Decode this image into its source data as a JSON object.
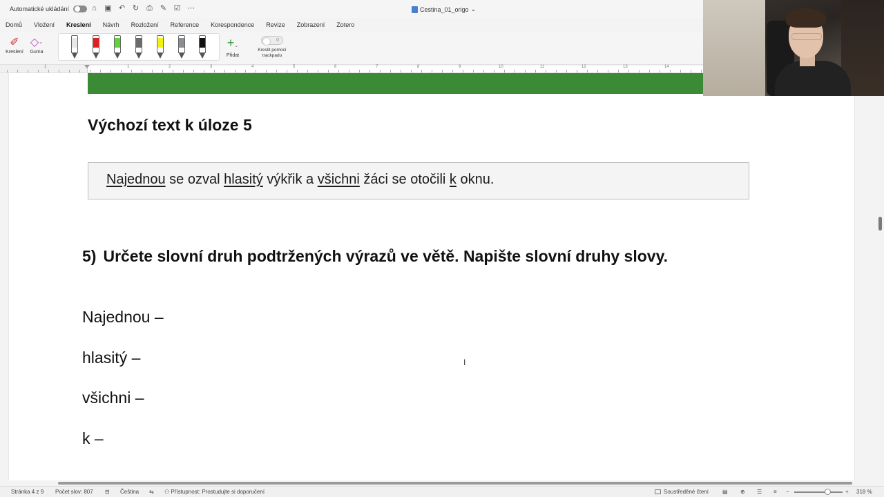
{
  "titlebar": {
    "autosave_label": "Automatické ukládání",
    "document_title": "Cestina_01_origo"
  },
  "ribbon_tabs": [
    "Domů",
    "Vložení",
    "Kreslení",
    "Návrh",
    "Rozložení",
    "Reference",
    "Korespondence",
    "Revize",
    "Zobrazení",
    "Zotero"
  ],
  "active_tab": "Kreslení",
  "ribbon": {
    "draw_label": "Kreslení",
    "eraser_label": "Guma",
    "add_label": "Přidat",
    "trackpad_label": "Kreslit pomocí trackpadu",
    "trackpad_toggle_value": "0",
    "pens": [
      {
        "name": "pencil-gray",
        "color": "#e8e8e8"
      },
      {
        "name": "pen-red",
        "color": "#e02020"
      },
      {
        "name": "pen-green",
        "color": "#5fd33a"
      },
      {
        "name": "pencil-dark",
        "color": "#6b6b6b"
      },
      {
        "name": "highlighter-yellow",
        "color": "#f3f016"
      },
      {
        "name": "highlighter-gray",
        "color": "#8a8f93"
      },
      {
        "name": "pen-black",
        "color": "#111111"
      }
    ]
  },
  "ruler": {
    "numbers": [
      "1",
      "1",
      "2",
      "3",
      "4",
      "5",
      "6",
      "7",
      "8",
      "9",
      "10",
      "11",
      "12",
      "13",
      "14"
    ]
  },
  "document": {
    "heading": "Výchozí text k úloze 5",
    "source_sentence": {
      "w1": "Najednou",
      "t1": " se ozval ",
      "w2": "hlasitý",
      "t2": " výkřik a ",
      "w3": "všichni",
      "t3": " žáci se otočili ",
      "w4": "k",
      "t4": " oknu."
    },
    "task_number": "5)",
    "task_text": "Určete slovní druh podtržených výrazů ve větě. Napište slovní druhy slovy.",
    "answers": [
      "Najednou –",
      "hlasitý –",
      "všichni –",
      "k –"
    ]
  },
  "statusbar": {
    "page": "Stránka 4 z 9",
    "word_count": "Počet slov: 807",
    "language": "Čeština",
    "accessibility": "Přístupnost: Prostudujte si doporučení",
    "focus": "Soustředěné čtení",
    "zoom": "318 %"
  },
  "colors": {
    "banner_green": "#3a8a36",
    "accent_blue": "#2b579a"
  }
}
